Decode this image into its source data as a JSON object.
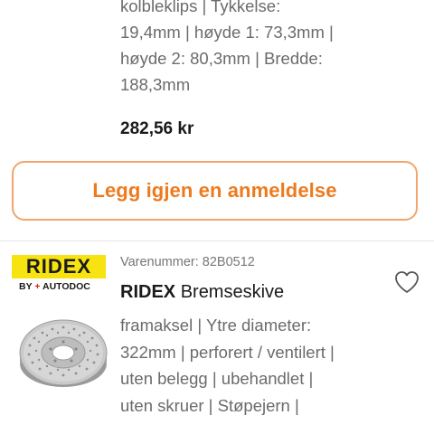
{
  "previous_product": {
    "description_lines": [
      "kolbleklips | Tykkelse:",
      "19,4mm | høyde 1: 73,3mm |",
      "høyde 2: 80,3mm | Bredde:",
      "188,3mm"
    ],
    "price": "282,56 kr"
  },
  "review_button": {
    "label": "Legg igjen en anmeldelse"
  },
  "product": {
    "brand_logo": "RIDEX",
    "brand_logo_sub_prefix": "BY",
    "brand_logo_sub_plus": "+",
    "brand_logo_sub": "AUTODOC",
    "part_number": "Varenummer: 82B0512",
    "brand": "RIDEX",
    "name": "Bremseskive",
    "description_lines": [
      "framaksel | Ytre diameter:",
      "322mm | perforert / ventilert |",
      "uten belegg | ubehandlet |",
      "uten skruer | Støpejern |"
    ],
    "favorite_icon": "heart-outline-icon",
    "image_icon": "brake-disc-image"
  },
  "colors": {
    "accent": "#ee7a1e",
    "button_border": "#f3a56b",
    "ridex_yellow": "#f6e30f",
    "autodoc_red": "#e2231a",
    "muted_text": "#6b6b6b"
  }
}
